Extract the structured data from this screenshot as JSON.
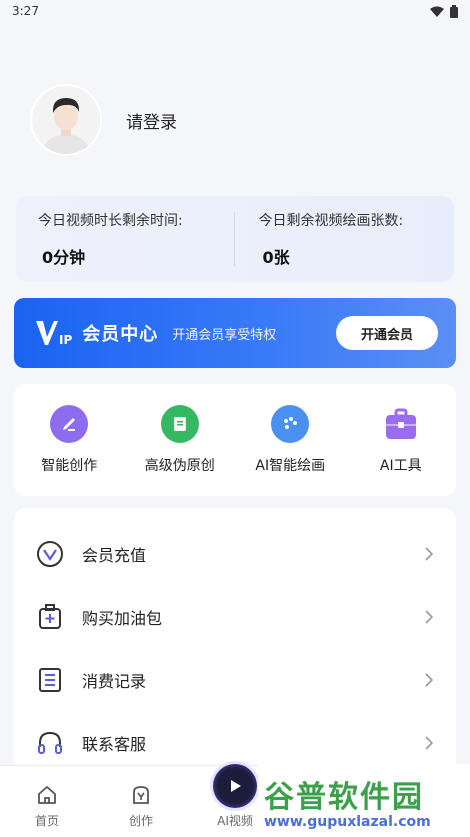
{
  "status_bar": {
    "time": "3:27"
  },
  "profile": {
    "login_text": "请登录"
  },
  "quota": {
    "video_time_label": "今日视频时长剩余时间:",
    "video_time_value": "0分钟",
    "drawing_label": "今日剩余视频绘画张数:",
    "drawing_value": "0张"
  },
  "vip": {
    "logo_text": "IP",
    "title": "会员中心",
    "subtitle": "开通会员享受特权",
    "button_label": "开通会员"
  },
  "tools": [
    {
      "label": "智能创作",
      "icon": "pen-icon",
      "color": "#8d6cf0"
    },
    {
      "label": "高级伪原创",
      "icon": "document-icon",
      "color": "#34b862"
    },
    {
      "label": "AI智能绘画",
      "icon": "palette-icon",
      "color": "#4a90f0"
    },
    {
      "label": "AI工具",
      "icon": "toolbox-icon",
      "color": "#9a6cf0"
    }
  ],
  "menu": [
    {
      "label": "会员充值",
      "icon": "vip-circle-icon"
    },
    {
      "label": "购买加油包",
      "icon": "plus-bag-icon"
    },
    {
      "label": "消费记录",
      "icon": "list-icon"
    },
    {
      "label": "联系客服",
      "icon": "headset-icon"
    }
  ],
  "bottom_nav": {
    "home": "首页",
    "create": "创作",
    "ai_video": "AI视频"
  },
  "watermark": {
    "main": "谷普软件园",
    "sub": "www.gupuxlazal.com"
  }
}
